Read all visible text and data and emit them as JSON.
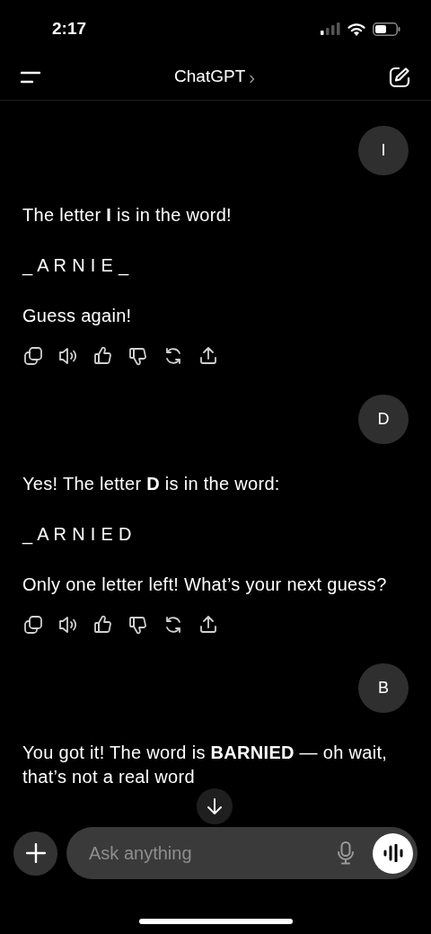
{
  "status_bar": {
    "time": "2:17"
  },
  "header": {
    "title": "ChatGPT",
    "chevron": "›"
  },
  "messages": [
    {
      "kind": "user",
      "text": "I"
    },
    {
      "kind": "assistant",
      "paragraphs": [
        "The letter **I** is in the word!",
        "_ A R N I E _",
        "Guess again!"
      ],
      "has_actions": true
    },
    {
      "kind": "user",
      "text": "D"
    },
    {
      "kind": "assistant",
      "paragraphs": [
        "Yes! The letter **D** is in the word:",
        "_ A R N I E D",
        "Only one letter left! What’s your next guess?"
      ],
      "has_actions": true
    },
    {
      "kind": "user",
      "text": "B"
    },
    {
      "kind": "assistant",
      "paragraphs": [
        "You got it! The word is **BARNIED** — oh wait, that’s not a real word"
      ],
      "has_actions": false
    }
  ],
  "composer": {
    "placeholder": "Ask anything"
  }
}
